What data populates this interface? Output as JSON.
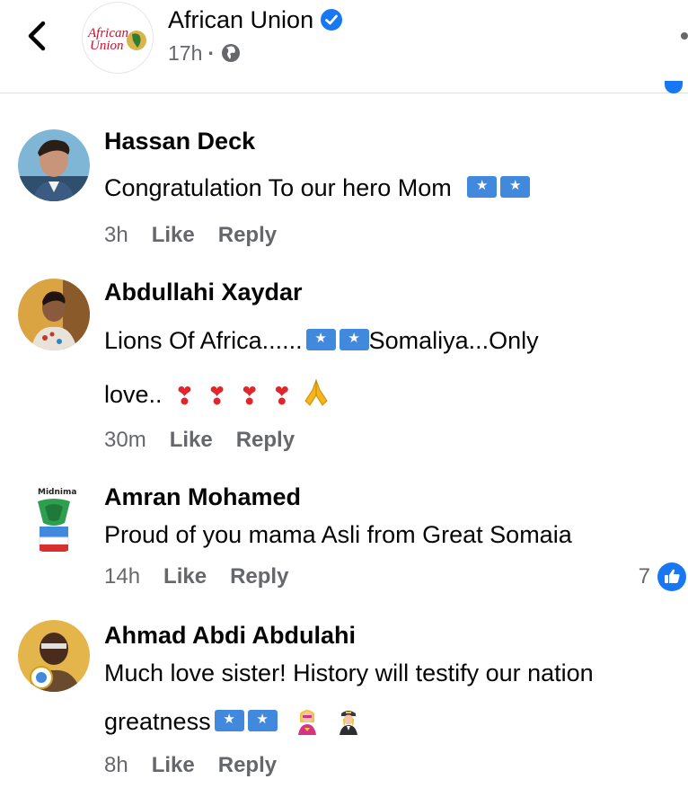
{
  "header": {
    "page_name": "African Union",
    "logo_text_line1": "African",
    "logo_text_line2": "Union",
    "time": "17h",
    "separator": "·"
  },
  "comments": [
    {
      "name": "Hassan Deck",
      "text": "Congratulation To our hero Mom",
      "flags": 2,
      "time": "3h",
      "like_label": "Like",
      "reply_label": "Reply"
    },
    {
      "name": "Abdullahi Xaydar",
      "text_line1_a": "Lions Of Africa......",
      "text_line1_b": "Somaliya...Only",
      "text_line2": "love..",
      "time": "30m",
      "like_label": "Like",
      "reply_label": "Reply"
    },
    {
      "name": "Amran Mohamed",
      "text": "Proud of you mama Asli from Great Somaia",
      "time": "14h",
      "like_label": "Like",
      "reply_label": "Reply",
      "reaction_count": "7",
      "avatar_text": "Midnima"
    },
    {
      "name": "Ahmad Abdi Abdulahi",
      "text_line1": "Much love sister! History will testify our nation",
      "text_line2": "greatness",
      "time": "8h",
      "like_label": "Like",
      "reply_label": "Reply"
    }
  ],
  "colors": {
    "accent": "#1877f2",
    "secondary_text": "#65676b",
    "primary_text": "#050505",
    "flag_blue": "#4189dd"
  },
  "icons": [
    "back-arrow-icon",
    "verified-badge-icon",
    "globe-icon",
    "somali-flag-icon",
    "heart-exclamation-icon",
    "folded-hands-icon",
    "like-thumb-icon"
  ]
}
